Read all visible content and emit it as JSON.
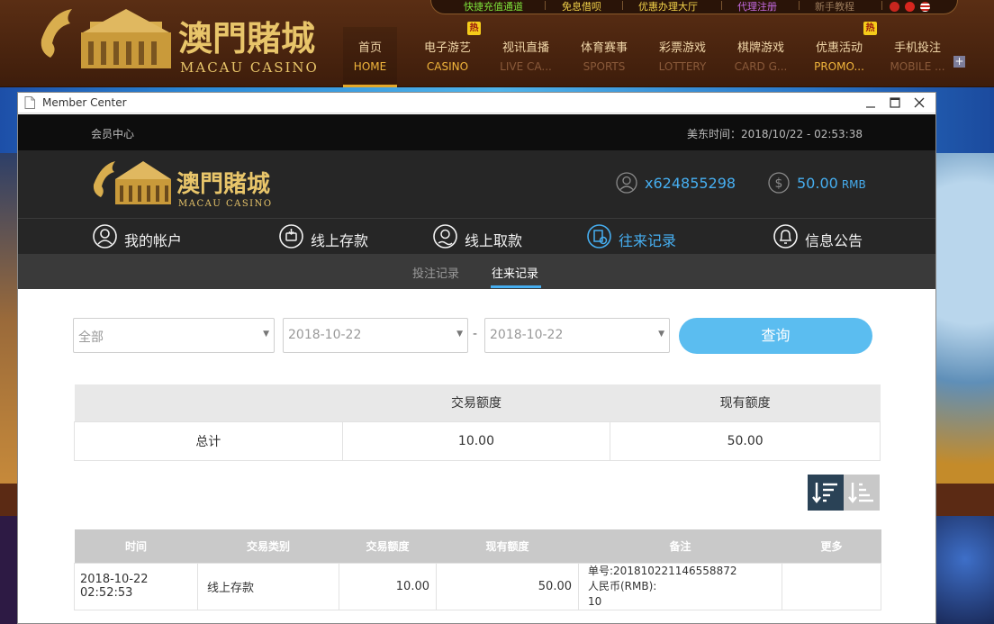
{
  "site": {
    "top_links": [
      "快捷充值通道",
      "免息借呗",
      "优惠办理大厅",
      "代理注册",
      "新手教程"
    ],
    "nav": [
      {
        "zh": "首页",
        "en": "HOME",
        "active": true,
        "hot": false
      },
      {
        "zh": "电子游艺",
        "en": "CASINO",
        "active": false,
        "hot": true
      },
      {
        "zh": "视讯直播",
        "en": "LIVE CA...",
        "active": false,
        "hot": false
      },
      {
        "zh": "体育赛事",
        "en": "SPORTS",
        "active": false,
        "hot": false
      },
      {
        "zh": "彩票游戏",
        "en": "LOTTERY",
        "active": false,
        "hot": false
      },
      {
        "zh": "棋牌游戏",
        "en": "CARD G...",
        "active": false,
        "hot": false
      },
      {
        "zh": "优惠活动",
        "en": "PROMO...",
        "active": false,
        "hot": true
      },
      {
        "zh": "手机投注",
        "en": "MOBILE ...",
        "active": false,
        "hot": false
      }
    ],
    "hot_badge": "热",
    "logo_zh": "澳門賭城",
    "logo_en": "MACAU CASINO"
  },
  "window": {
    "title": "Member Center"
  },
  "member": {
    "breadcrumb": "会员中心",
    "time_label": "美东时间：2018/10/22 - 02:53:38",
    "username": "x624855298",
    "balance": "50.00",
    "currency": "RMB",
    "menu": [
      {
        "label": "我的帐户",
        "icon": "user-icon",
        "active": false
      },
      {
        "label": "线上存款",
        "icon": "deposit-icon",
        "active": false
      },
      {
        "label": "线上取款",
        "icon": "withdraw-icon",
        "active": false
      },
      {
        "label": "往来记录",
        "icon": "records-icon",
        "active": true
      },
      {
        "label": "信息公告",
        "icon": "bell-icon",
        "active": false
      }
    ],
    "sub_tabs": [
      {
        "label": "投注记录",
        "active": false
      },
      {
        "label": "往来记录",
        "active": true
      }
    ],
    "filter": {
      "type_value": "全部",
      "date_from": "2018-10-22",
      "date_to": "2018-10-22",
      "dash": "-",
      "query_label": "查询"
    },
    "summary": {
      "headers": [
        "",
        "交易额度",
        "现有额度"
      ],
      "row": [
        "总计",
        "10.00",
        "50.00"
      ]
    },
    "records": {
      "headers": [
        "时间",
        "交易类别",
        "交易额度",
        "现有额度",
        "备注",
        "更多"
      ],
      "rows": [
        {
          "time": "2018-10-22 02:52:53",
          "type": "线上存款",
          "amount": "10.00",
          "balance": "50.00",
          "note": [
            "单号:201810221146558872",
            "人民币(RMB):",
            "10"
          ],
          "more": ""
        }
      ]
    }
  },
  "colors": {
    "accent": "#46aef0",
    "gold": "#e3a82b",
    "dark_bar": "#262626"
  }
}
